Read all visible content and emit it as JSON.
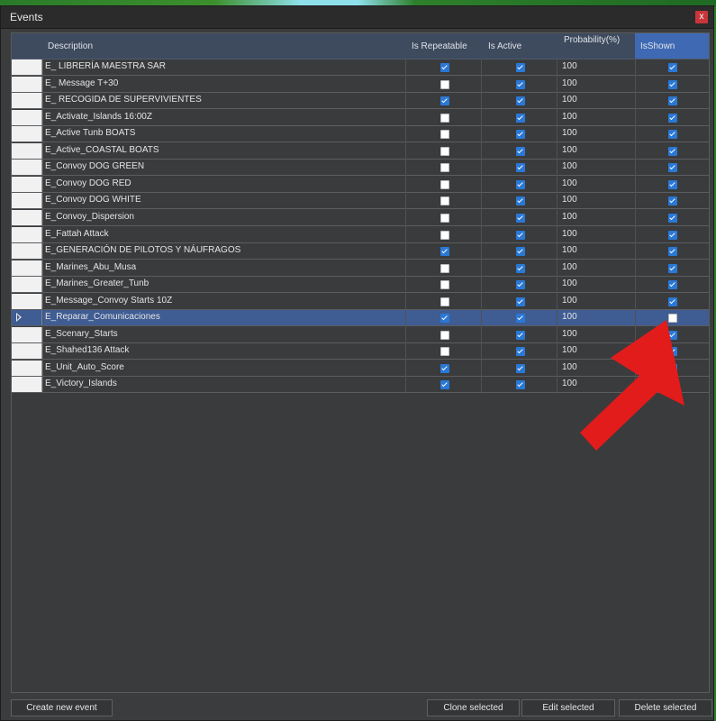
{
  "window": {
    "title": "Events",
    "close_label": "x"
  },
  "columns": {
    "description": "Description",
    "repeatable": "Is Repeatable",
    "active": "Is Active",
    "probability": [
      "Probability",
      "(%)"
    ],
    "shown": "IsShown"
  },
  "rows": [
    {
      "description": "E_ LIBRERÍA MAESTRA SAR",
      "repeatable": true,
      "active": true,
      "probability": "100",
      "shown": true,
      "selected": false
    },
    {
      "description": "E_ Message T+30",
      "repeatable": false,
      "active": true,
      "probability": "100",
      "shown": true,
      "selected": false
    },
    {
      "description": "E_ RECOGIDA DE SUPERVIVIENTES",
      "repeatable": true,
      "active": true,
      "probability": "100",
      "shown": true,
      "selected": false
    },
    {
      "description": "E_Activate_Islands 16:00Z",
      "repeatable": false,
      "active": true,
      "probability": "100",
      "shown": true,
      "selected": false
    },
    {
      "description": "E_Active Tunb BOATS",
      "repeatable": false,
      "active": true,
      "probability": "100",
      "shown": true,
      "selected": false
    },
    {
      "description": "E_Active_COASTAL BOATS",
      "repeatable": false,
      "active": true,
      "probability": "100",
      "shown": true,
      "selected": false
    },
    {
      "description": "E_Convoy DOG GREEN",
      "repeatable": false,
      "active": true,
      "probability": "100",
      "shown": true,
      "selected": false
    },
    {
      "description": "E_Convoy DOG RED",
      "repeatable": false,
      "active": true,
      "probability": "100",
      "shown": true,
      "selected": false
    },
    {
      "description": "E_Convoy DOG WHITE",
      "repeatable": false,
      "active": true,
      "probability": "100",
      "shown": true,
      "selected": false
    },
    {
      "description": "E_Convoy_Dispersion",
      "repeatable": false,
      "active": true,
      "probability": "100",
      "shown": true,
      "selected": false
    },
    {
      "description": "E_Fattah Attack",
      "repeatable": false,
      "active": true,
      "probability": "100",
      "shown": true,
      "selected": false
    },
    {
      "description": "E_GENERACIÓN DE PILOTOS Y NÁUFRAGOS",
      "repeatable": true,
      "active": true,
      "probability": "100",
      "shown": true,
      "selected": false
    },
    {
      "description": "E_Marines_Abu_Musa",
      "repeatable": false,
      "active": true,
      "probability": "100",
      "shown": true,
      "selected": false
    },
    {
      "description": "E_Marines_Greater_Tunb",
      "repeatable": false,
      "active": true,
      "probability": "100",
      "shown": true,
      "selected": false
    },
    {
      "description": "E_Message_Convoy Starts 10Z",
      "repeatable": false,
      "active": true,
      "probability": "100",
      "shown": true,
      "selected": false
    },
    {
      "description": "E_Reparar_Comunicaciones",
      "repeatable": true,
      "active": true,
      "probability": "100",
      "shown": false,
      "selected": true
    },
    {
      "description": "E_Scenary_Starts",
      "repeatable": false,
      "active": true,
      "probability": "100",
      "shown": true,
      "selected": false
    },
    {
      "description": "E_Shahed136 Attack",
      "repeatable": false,
      "active": true,
      "probability": "100",
      "shown": true,
      "selected": false
    },
    {
      "description": "E_Unit_Auto_Score",
      "repeatable": true,
      "active": true,
      "probability": "100",
      "shown": true,
      "selected": false
    },
    {
      "description": "E_Victory_Islands",
      "repeatable": true,
      "active": true,
      "probability": "100",
      "shown": true,
      "selected": false
    }
  ],
  "buttons": {
    "create": "Create new event",
    "clone": "Clone selected",
    "edit": "Edit selected",
    "delete": "Delete selected"
  },
  "colors": {
    "accent": "#3f6ab3",
    "selected_row": "#3f5c93",
    "checkbox_on": "#2a78d6",
    "annotation_arrow": "#e21b1b"
  }
}
